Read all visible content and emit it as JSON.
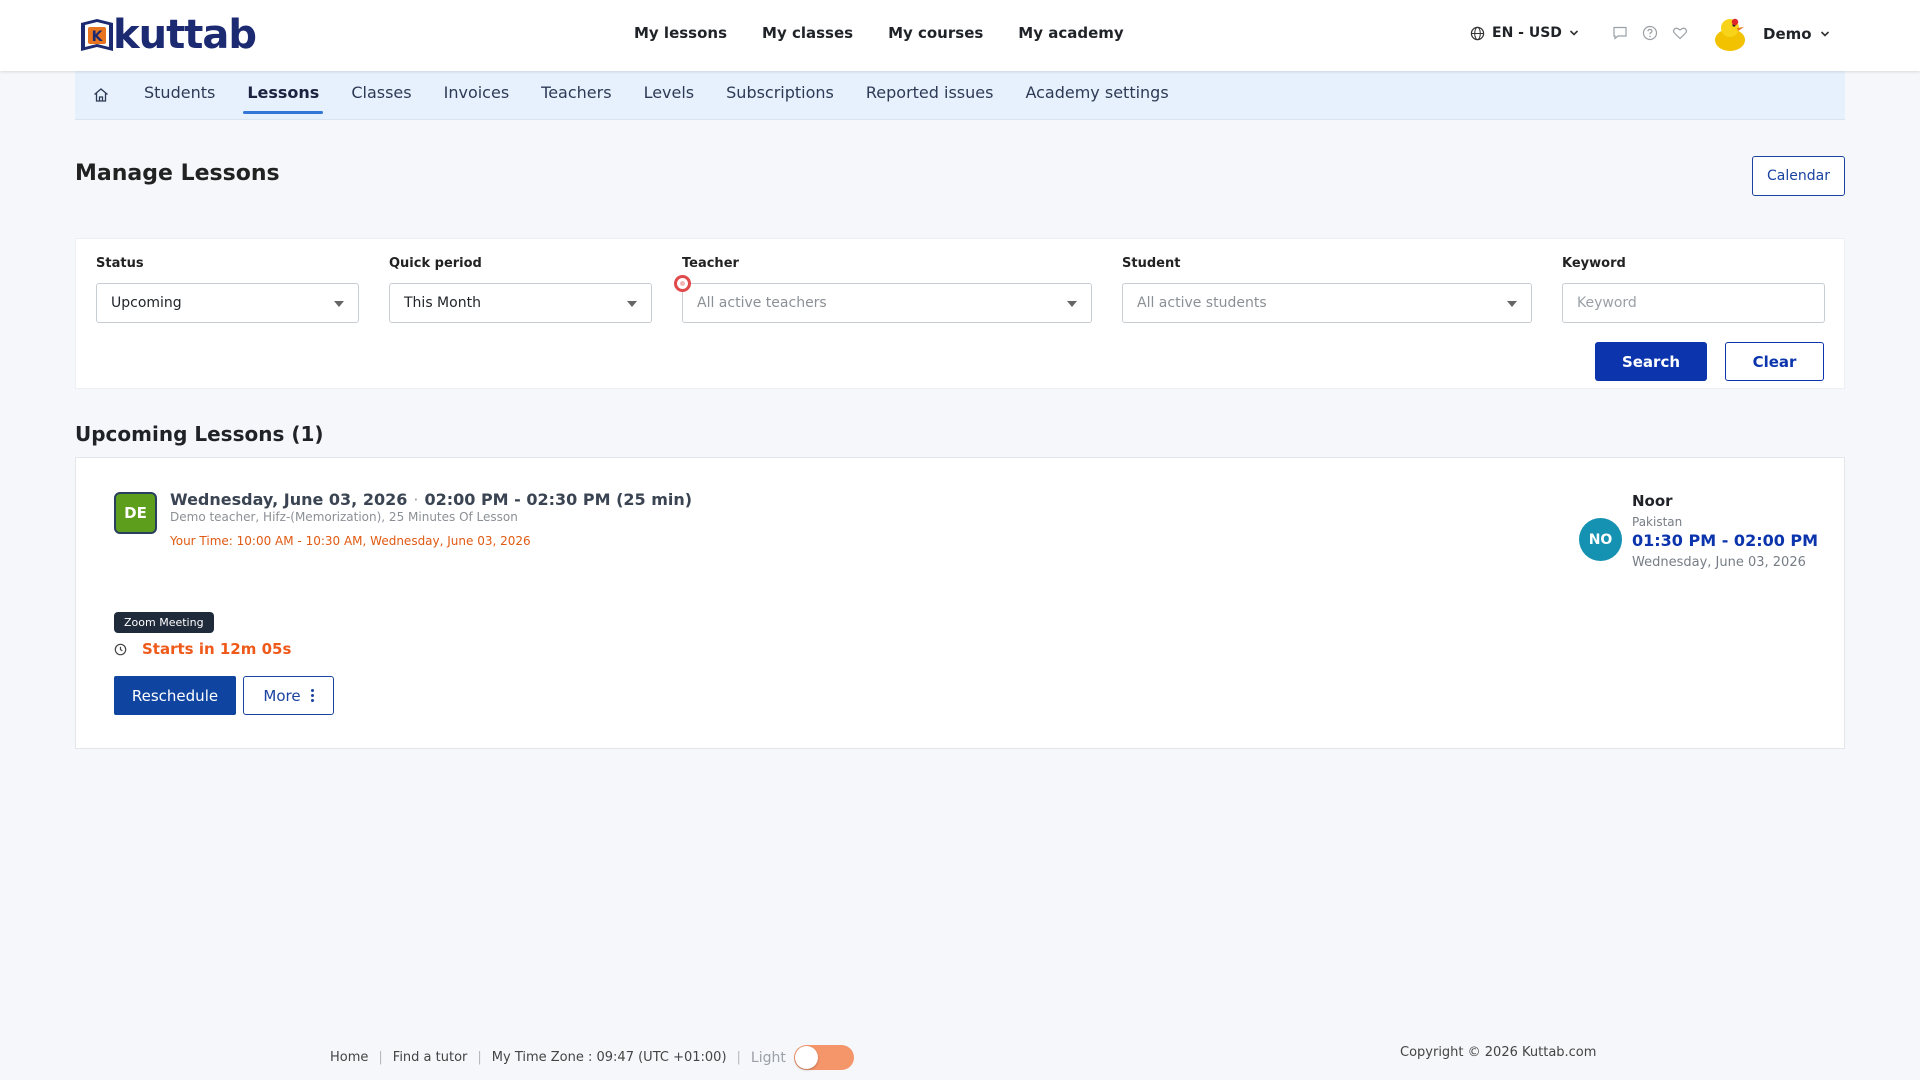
{
  "brand": {
    "name": "kuttab",
    "mark_letter": "K",
    "color": "#1c2a72",
    "accent": "#e8741f"
  },
  "main_nav": [
    {
      "label": "My lessons"
    },
    {
      "label": "My classes"
    },
    {
      "label": "My courses"
    },
    {
      "label": "My academy"
    }
  ],
  "header": {
    "language": "EN - USD",
    "icons": [
      "chat-icon",
      "help-icon",
      "heart-icon"
    ],
    "user_name": "Demo"
  },
  "sub_nav": {
    "home_icon": "home-icon",
    "items": [
      {
        "label": "Students"
      },
      {
        "label": "Lessons",
        "active": true
      },
      {
        "label": "Classes"
      },
      {
        "label": "Invoices"
      },
      {
        "label": "Teachers"
      },
      {
        "label": "Levels"
      },
      {
        "label": "Subscriptions"
      },
      {
        "label": "Reported issues"
      },
      {
        "label": "Academy settings"
      }
    ]
  },
  "page": {
    "title": "Manage Lessons",
    "calendar_button": "Calendar"
  },
  "filters": {
    "status": {
      "label": "Status",
      "value": "Upcoming"
    },
    "quick_period": {
      "label": "Quick period",
      "value": "This Month"
    },
    "teacher": {
      "label": "Teacher",
      "placeholder": "All active teachers"
    },
    "student": {
      "label": "Student",
      "placeholder": "All active students"
    },
    "keyword": {
      "label": "Keyword",
      "placeholder": "Keyword",
      "value": ""
    },
    "search_button": "Search",
    "clear_button": "Clear"
  },
  "lessons": {
    "section_title": "Upcoming Lessons (1)",
    "items": [
      {
        "teacher_initials": "DE",
        "date": "Wednesday, June 03, 2026",
        "time": "02:00 PM - 02:30 PM (25 min)",
        "description": "Demo teacher, Hifz-(Memorization), 25 Minutes Of Lesson",
        "your_time": "Your Time: 10:00 AM - 10:30 AM, Wednesday, June 03, 2026",
        "platform_badge": "Zoom Meeting",
        "countdown": "Starts in 12m 05s",
        "reschedule_button": "Reschedule",
        "more_button": "More",
        "student": {
          "initials": "NO",
          "name": "Noor",
          "country": "Pakistan",
          "time": "01:30 PM - 02:00 PM",
          "date": "Wednesday, June 03, 2026"
        }
      }
    ]
  },
  "footer": {
    "links": [
      "Home",
      "Find a tutor"
    ],
    "timezone": "My Time Zone : 09:47 (UTC +01:00)",
    "theme_label": "Light",
    "copyright": "Copyright © 2026 Kuttab.com"
  },
  "colors": {
    "primary": "#0b34ad",
    "warning_text": "#e05a12",
    "teacher_avatar": "#5d9e1c",
    "student_avatar": "#1592b2",
    "toggle": "#f4956a"
  }
}
